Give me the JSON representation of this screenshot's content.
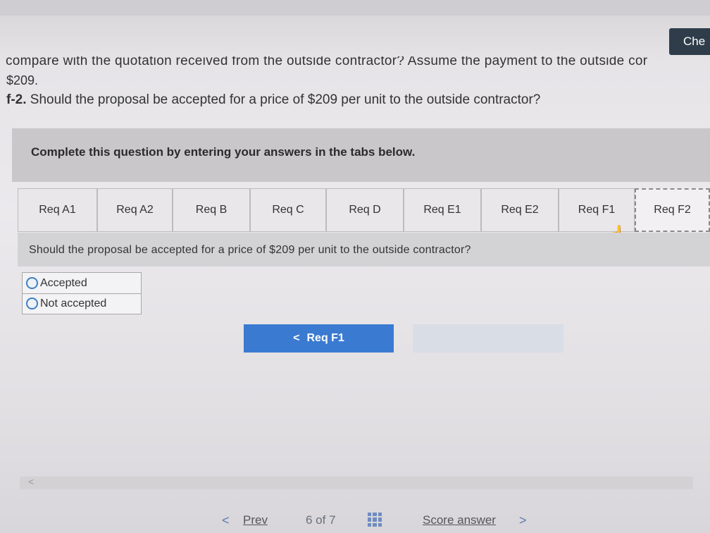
{
  "header": {
    "check_label": "Che",
    "cut_text": "compare with the quotation received from the outside contractor? Assume the payment to the outside cor",
    "amount": "$209.",
    "question_label": "f-2.",
    "question_text": " Should the proposal be accepted for a price of $209 per unit to the outside contractor?"
  },
  "instructions": "Complete this question by entering your answers in the tabs below.",
  "tabs": [
    {
      "label": "Req A1",
      "active": false
    },
    {
      "label": "Req A2",
      "active": false
    },
    {
      "label": "Req B",
      "active": false
    },
    {
      "label": "Req C",
      "active": false
    },
    {
      "label": "Req D",
      "active": false
    },
    {
      "label": "Req E1",
      "active": false
    },
    {
      "label": "Req E2",
      "active": false
    },
    {
      "label": "Req F1",
      "active": false
    },
    {
      "label": "Req F2",
      "active": true
    }
  ],
  "question": "Should the proposal be accepted for a price of $209 per unit to the outside contractor?",
  "options": [
    {
      "label": "Accepted"
    },
    {
      "label": "Not accepted"
    }
  ],
  "nav": {
    "prev_button_label": "Req F1",
    "prev_chevron": "<"
  },
  "footer": {
    "prev_label": "Prev",
    "page": "6 of 7",
    "score_label": "Score answer",
    "chevron_left": "<",
    "chevron_right": ">"
  },
  "colors": {
    "accent": "#3a7bd1",
    "check_button": "#2f3d4a"
  }
}
